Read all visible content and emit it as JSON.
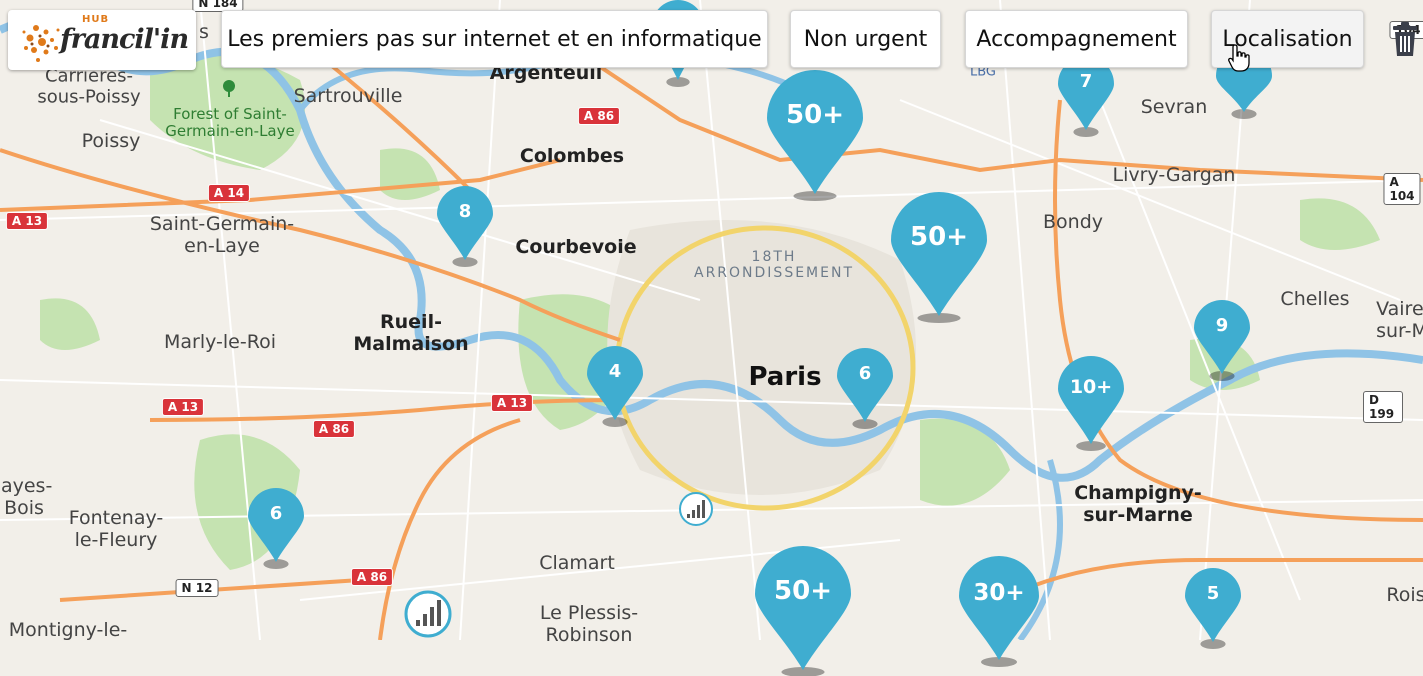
{
  "app": {
    "logo_hub": "HUB",
    "logo_name": "francil'in"
  },
  "filters": {
    "theme": "Les premiers pas sur internet et en informatique",
    "urgency": "Non urgent",
    "type": "Accompagnement",
    "location": "Localisation"
  },
  "map": {
    "places": {
      "carrieres": "Carrieres-\nsous-Poissy",
      "poissy": "Poissy",
      "sartrouville": "Sartrouville",
      "forest": "Forest of Saint-\nGermain-en-Laye",
      "argenteuil": "Argenteuil",
      "colombes": "Colombes",
      "courbevoie": "Courbevoie",
      "saint_germain": "Saint-Germain-\nen-Laye",
      "rueil": "Rueil-\nMalmaison",
      "marly": "Marly-le-Roi",
      "paris": "Paris",
      "arr18": "18TH\nARRONDISSEMENT",
      "sevran": "Sevran",
      "livry": "Livry-Gargan",
      "bondy": "Bondy",
      "chelles": "Chelles",
      "vaires": "Vaire\nsur-M",
      "champigny": "Champigny-\nsur-Marne",
      "clamart": "Clamart",
      "plessis": "Le Plessis-\nRobinson",
      "fontenay": "Fontenay-\nle-Fleury",
      "clayes": "layes-\nBois",
      "montigny": "Montigny-le-",
      "roissy": "Rois",
      "lbg": "LBG",
      "s_partial": "s"
    },
    "roads": {
      "n184": "N 184",
      "a86_top": "A 86",
      "a14": "A 14",
      "a13_left": "A 13",
      "a13_mid": "A 13",
      "a13_center": "A 13",
      "a86_mid": "A 86",
      "a86_bottom": "A 86",
      "n12": "N 12",
      "a104": "A 104",
      "a104_top": "104",
      "d199": "D 199"
    },
    "clusters": [
      {
        "label": "50+"
      },
      {
        "label": "50+"
      },
      {
        "label": "8"
      },
      {
        "label": "7"
      },
      {
        "label": "9"
      },
      {
        "label": "10+"
      },
      {
        "label": "4"
      },
      {
        "label": "6"
      },
      {
        "label": "6"
      },
      {
        "label": "50+"
      },
      {
        "label": "30+"
      },
      {
        "label": "5"
      },
      {
        "label": ""
      },
      {
        "label": ""
      },
      {
        "label": ""
      }
    ],
    "marker_color": "#3fadd0",
    "accent_logo": "#e07a1a"
  },
  "icons": {
    "trash": "trash-icon",
    "signal": "signal-bars-icon",
    "tree": "tree-icon",
    "cursor": "hand-pointer-icon"
  }
}
